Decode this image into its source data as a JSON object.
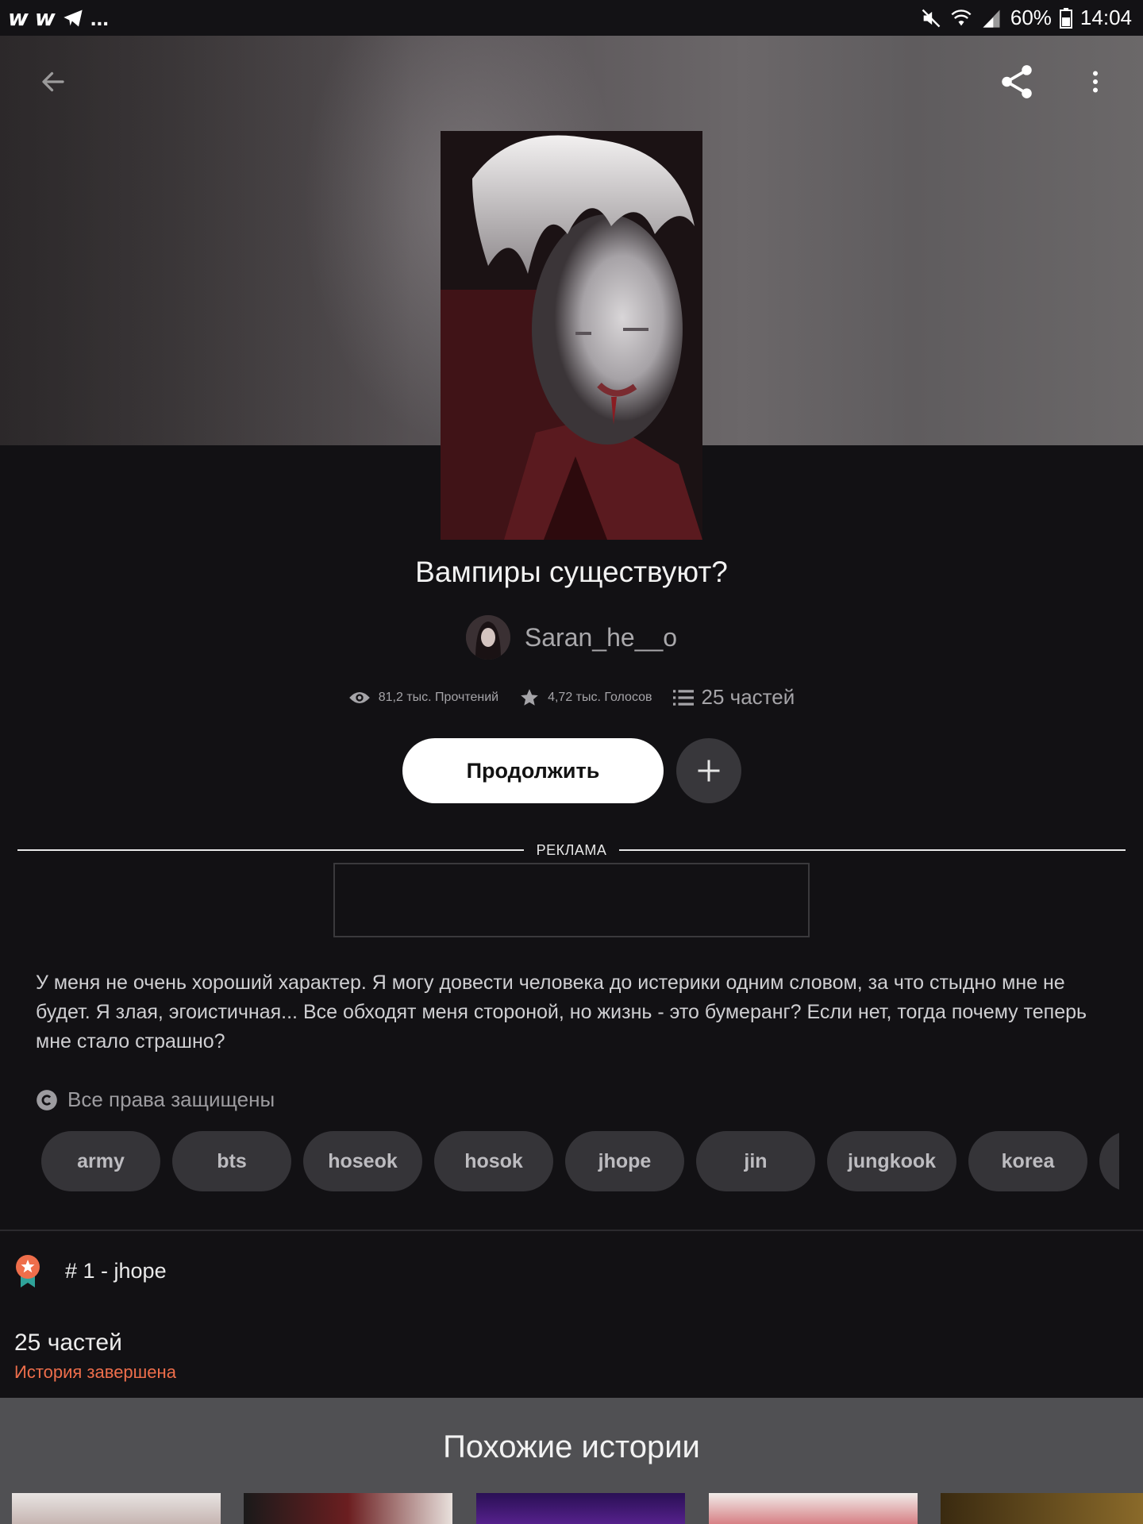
{
  "status_bar": {
    "left_icons": [
      "wattpad-icon",
      "wattpad-icon",
      "telegram-icon"
    ],
    "more": "...",
    "battery": "60%",
    "time": "14:04"
  },
  "story": {
    "title": "Вампиры существуют?",
    "author": "Saran_he__o",
    "reads": "81,2 тыс. Прочтений",
    "votes": "4,72 тыс. Голосов",
    "parts_stat": "25 частей",
    "continue_label": "Продолжить",
    "ad_label": "РЕКЛАМА",
    "description": "У меня не очень хороший характер. Я могу довести человека до истерики одним словом, за что стыдно мне не будет. Я злая, эгоистичная... Все обходят меня стороной, но жизнь - это бумеранг? Если нет, тогда почему теперь мне стало страшно?",
    "copyright": "Все права защищены",
    "tags": [
      "army",
      "bts",
      "hoseok",
      "hosok",
      "jhope",
      "jin",
      "jungkook",
      "korea"
    ],
    "rank": "# 1 - jhope",
    "parts_count": "25 частей",
    "status": "История завершена"
  },
  "similar": {
    "title": "Похожие истории"
  },
  "colors": {
    "background": "#121114",
    "accent": "#ee6e4b",
    "tag_bg": "#353438"
  }
}
